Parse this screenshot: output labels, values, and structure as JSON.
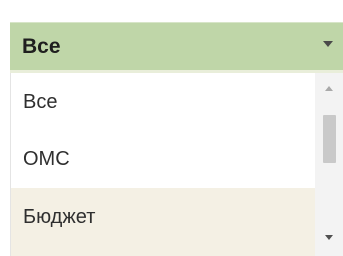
{
  "select": {
    "value": "Все"
  },
  "options": [
    {
      "label": "Все"
    },
    {
      "label": "ОМС"
    },
    {
      "label": "Бюджет"
    }
  ],
  "icons": {
    "dropdown_arrow": "chevron-down-icon",
    "scroll_up": "chevron-up-icon",
    "scroll_down": "chevron-down-icon"
  },
  "colors": {
    "header_background": "#bfd6a8",
    "highlighted_option_background": "#f4f0e4",
    "scrollbar_thumb": "#c9c9c9"
  }
}
